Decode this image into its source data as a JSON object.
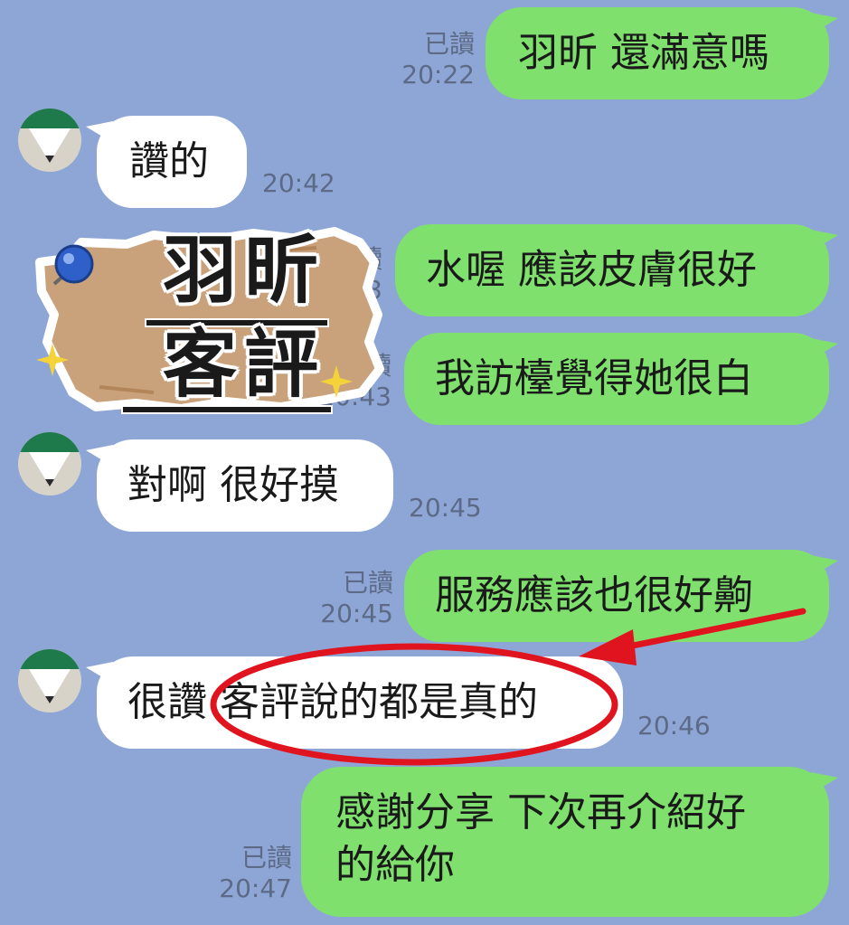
{
  "messages": [
    {
      "id": "m1",
      "side": "sent",
      "text": "羽昕 還滿意嗎",
      "read": "已讀",
      "time": "20:22"
    },
    {
      "id": "m2",
      "side": "recv",
      "text": "讚的",
      "time": "20:42"
    },
    {
      "id": "m3",
      "side": "sent",
      "text": "水喔 應該皮膚很好",
      "read": "讀",
      "time": "43"
    },
    {
      "id": "m4",
      "side": "sent",
      "text": "我訪檯覺得她很白",
      "read": "讀",
      "time": "20:43"
    },
    {
      "id": "m5",
      "side": "recv",
      "text": "對啊 很好摸",
      "time": "20:45"
    },
    {
      "id": "m6",
      "side": "sent",
      "text": "服務應該也很好齁",
      "read": "已讀",
      "time": "20:45"
    },
    {
      "id": "m7",
      "side": "recv",
      "text": "很讚 客評說的都是真的",
      "time": "20:46"
    },
    {
      "id": "m8",
      "side": "sent",
      "text_line1": "感謝分享 下次再介紹好",
      "text_line2": "的給你",
      "read": "已讀",
      "time": "20:47"
    }
  ],
  "sticker": {
    "line1": "羽昕",
    "line2": "客評"
  },
  "colors": {
    "background": "#8ea6d6",
    "sent_bubble": "#7fe06e",
    "recv_bubble": "#ffffff",
    "highlight": "#e0141e"
  },
  "icons": {
    "avatar": "pencil-avatar-icon",
    "pin": "pushpin-icon",
    "sparkle": "sparkle-icon"
  }
}
